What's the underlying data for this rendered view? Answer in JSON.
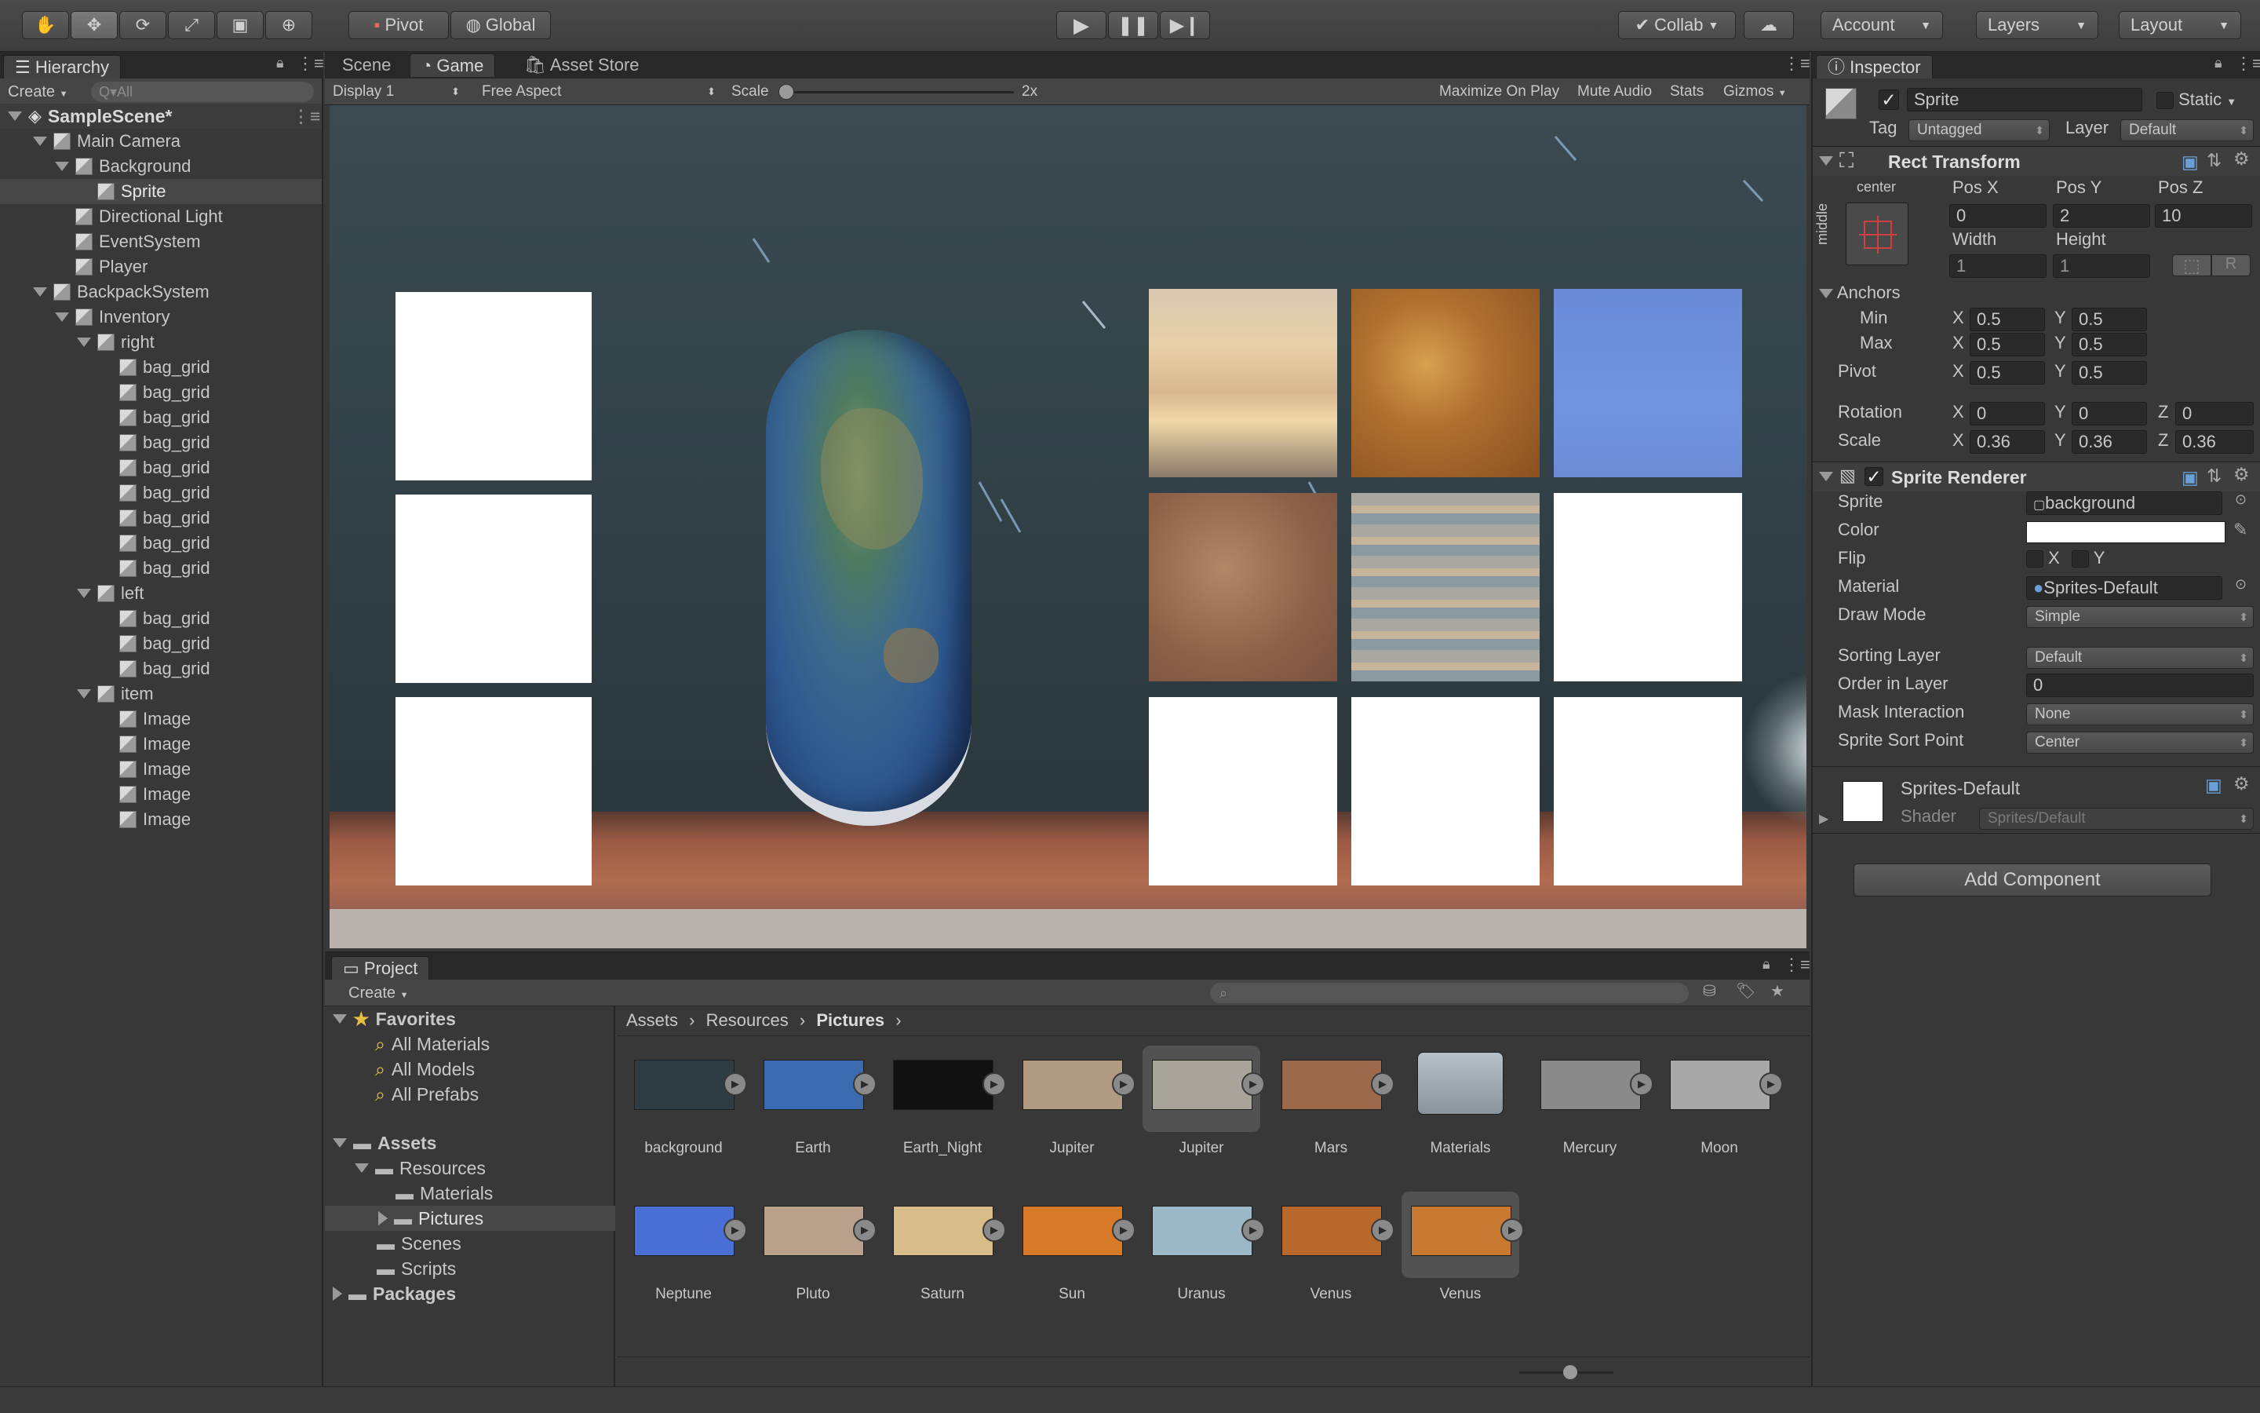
{
  "toolbar": {
    "pivot": "Pivot",
    "global": "Global",
    "collab": "Collab",
    "account": "Account",
    "layers": "Layers",
    "layout": "Layout"
  },
  "hierarchy": {
    "tab": "Hierarchy",
    "create": "Create",
    "search_placeholder": "Q▾All",
    "scene": "SampleScene*",
    "items": [
      {
        "label": "Main Camera",
        "depth": 1,
        "expander": "open"
      },
      {
        "label": "Background",
        "depth": 2,
        "expander": "open"
      },
      {
        "label": "Sprite",
        "depth": 3,
        "expander": "none",
        "selected": true
      },
      {
        "label": "Directional Light",
        "depth": 2,
        "expander": "none"
      },
      {
        "label": "EventSystem",
        "depth": 2,
        "expander": "none"
      },
      {
        "label": "Player",
        "depth": 2,
        "expander": "none"
      },
      {
        "label": "BackpackSystem",
        "depth": 1,
        "expander": "open"
      },
      {
        "label": "Inventory",
        "depth": 2,
        "expander": "open"
      },
      {
        "label": "right",
        "depth": 3,
        "expander": "open"
      },
      {
        "label": "bag_grid",
        "depth": 4,
        "expander": "none"
      },
      {
        "label": "bag_grid",
        "depth": 4,
        "expander": "none"
      },
      {
        "label": "bag_grid",
        "depth": 4,
        "expander": "none"
      },
      {
        "label": "bag_grid",
        "depth": 4,
        "expander": "none"
      },
      {
        "label": "bag_grid",
        "depth": 4,
        "expander": "none"
      },
      {
        "label": "bag_grid",
        "depth": 4,
        "expander": "none"
      },
      {
        "label": "bag_grid",
        "depth": 4,
        "expander": "none"
      },
      {
        "label": "bag_grid",
        "depth": 4,
        "expander": "none"
      },
      {
        "label": "bag_grid",
        "depth": 4,
        "expander": "none"
      },
      {
        "label": "left",
        "depth": 3,
        "expander": "open"
      },
      {
        "label": "bag_grid",
        "depth": 4,
        "expander": "none"
      },
      {
        "label": "bag_grid",
        "depth": 4,
        "expander": "none"
      },
      {
        "label": "bag_grid",
        "depth": 4,
        "expander": "none"
      },
      {
        "label": "item",
        "depth": 3,
        "expander": "open"
      },
      {
        "label": "Image",
        "depth": 4,
        "expander": "none"
      },
      {
        "label": "Image",
        "depth": 4,
        "expander": "none"
      },
      {
        "label": "Image",
        "depth": 4,
        "expander": "none"
      },
      {
        "label": "Image",
        "depth": 4,
        "expander": "none"
      },
      {
        "label": "Image",
        "depth": 4,
        "expander": "none"
      }
    ]
  },
  "center_tabs": {
    "scene": "Scene",
    "game": "Game",
    "asset_store": "Asset Store"
  },
  "game_bar": {
    "display": "Display 1",
    "aspect": "Free Aspect",
    "scale_label": "Scale",
    "scale_value": "2x",
    "maximize": "Maximize On Play",
    "mute": "Mute Audio",
    "stats": "Stats",
    "gizmos": "Gizmos"
  },
  "project": {
    "tab": "Project",
    "create": "Create",
    "favorites": {
      "title": "Favorites",
      "items": [
        "All Materials",
        "All Models",
        "All Prefabs"
      ]
    },
    "assets_tree": {
      "root": "Assets",
      "resources": "Resources",
      "materials": "Materials",
      "pictures": "Pictures",
      "scenes": "Scenes",
      "scripts": "Scripts",
      "packages": "Packages"
    },
    "breadcrumb": [
      "Assets",
      "Resources",
      "Pictures"
    ],
    "assets": [
      {
        "name": "background",
        "color": "#2e3c44"
      },
      {
        "name": "Earth",
        "color": "#3a6ab0"
      },
      {
        "name": "Earth_Night",
        "color": "#111111"
      },
      {
        "name": "Jupiter",
        "color": "#b09a82"
      },
      {
        "name": "Jupiter",
        "color": "#a8a49a"
      },
      {
        "name": "Mars",
        "color": "#9c6a4a"
      },
      {
        "name": "Materials",
        "color": "#9aa4ac"
      },
      {
        "name": "Mercury",
        "color": "#8a8a8a"
      },
      {
        "name": "Moon",
        "color": "#a8a8a8"
      },
      {
        "name": "Neptune",
        "color": "#4a70d8"
      },
      {
        "name": "Pluto",
        "color": "#b8a08a"
      },
      {
        "name": "Saturn",
        "color": "#d8bc8a"
      },
      {
        "name": "Sun",
        "color": "#d87a28"
      },
      {
        "name": "Uranus",
        "color": "#9ab8c8"
      },
      {
        "name": "Venus",
        "color": "#b8682a"
      },
      {
        "name": "Venus",
        "color": "#c87a30"
      }
    ]
  },
  "inspector": {
    "tab": "Inspector",
    "object_name": "Sprite",
    "static": "Static",
    "tag_label": "Tag",
    "tag_value": "Untagged",
    "layer_label": "Layer",
    "layer_value": "Default",
    "rect_transform": {
      "title": "Rect Transform",
      "anchor_h": "center",
      "anchor_v": "middle",
      "pos_x_label": "Pos X",
      "pos_y_label": "Pos Y",
      "pos_z_label": "Pos Z",
      "pos_x": "0",
      "pos_y": "2",
      "pos_z": "10",
      "width_label": "Width",
      "height_label": "Height",
      "width": "1",
      "height": "1",
      "r_label": "R",
      "anchors_label": "Anchors",
      "min_label": "Min",
      "max_label": "Max",
      "pivot_label": "Pivot",
      "min_x": "0.5",
      "min_y": "0.5",
      "max_x": "0.5",
      "max_y": "0.5",
      "pivot_x": "0.5",
      "pivot_y": "0.5",
      "rotation_label": "Rotation",
      "scale_label": "Scale",
      "rot_x": "0",
      "rot_y": "0",
      "rot_z": "0",
      "scale_x": "0.36",
      "scale_y": "0.36",
      "scale_z": "0.36",
      "x": "X",
      "y": "Y",
      "z": "Z"
    },
    "sprite_renderer": {
      "title": "Sprite Renderer",
      "sprite_label": "Sprite",
      "sprite_value": "background",
      "color_label": "Color",
      "flip_label": "Flip",
      "material_label": "Material",
      "material_value": "Sprites-Default",
      "draw_mode_label": "Draw Mode",
      "draw_mode_value": "Simple",
      "sorting_layer_label": "Sorting Layer",
      "sorting_layer_value": "Default",
      "order_label": "Order in Layer",
      "order_value": "0",
      "mask_label": "Mask Interaction",
      "mask_value": "None",
      "sort_point_label": "Sprite Sort Point",
      "sort_point_value": "Center"
    },
    "material": {
      "name": "Sprites-Default",
      "shader_label": "Shader",
      "shader_value": "Sprites/Default"
    },
    "add_component": "Add Component"
  },
  "colors": {
    "accent": "#4a7fbf",
    "selection": "#474747",
    "game_bg": "#2f3e45"
  }
}
